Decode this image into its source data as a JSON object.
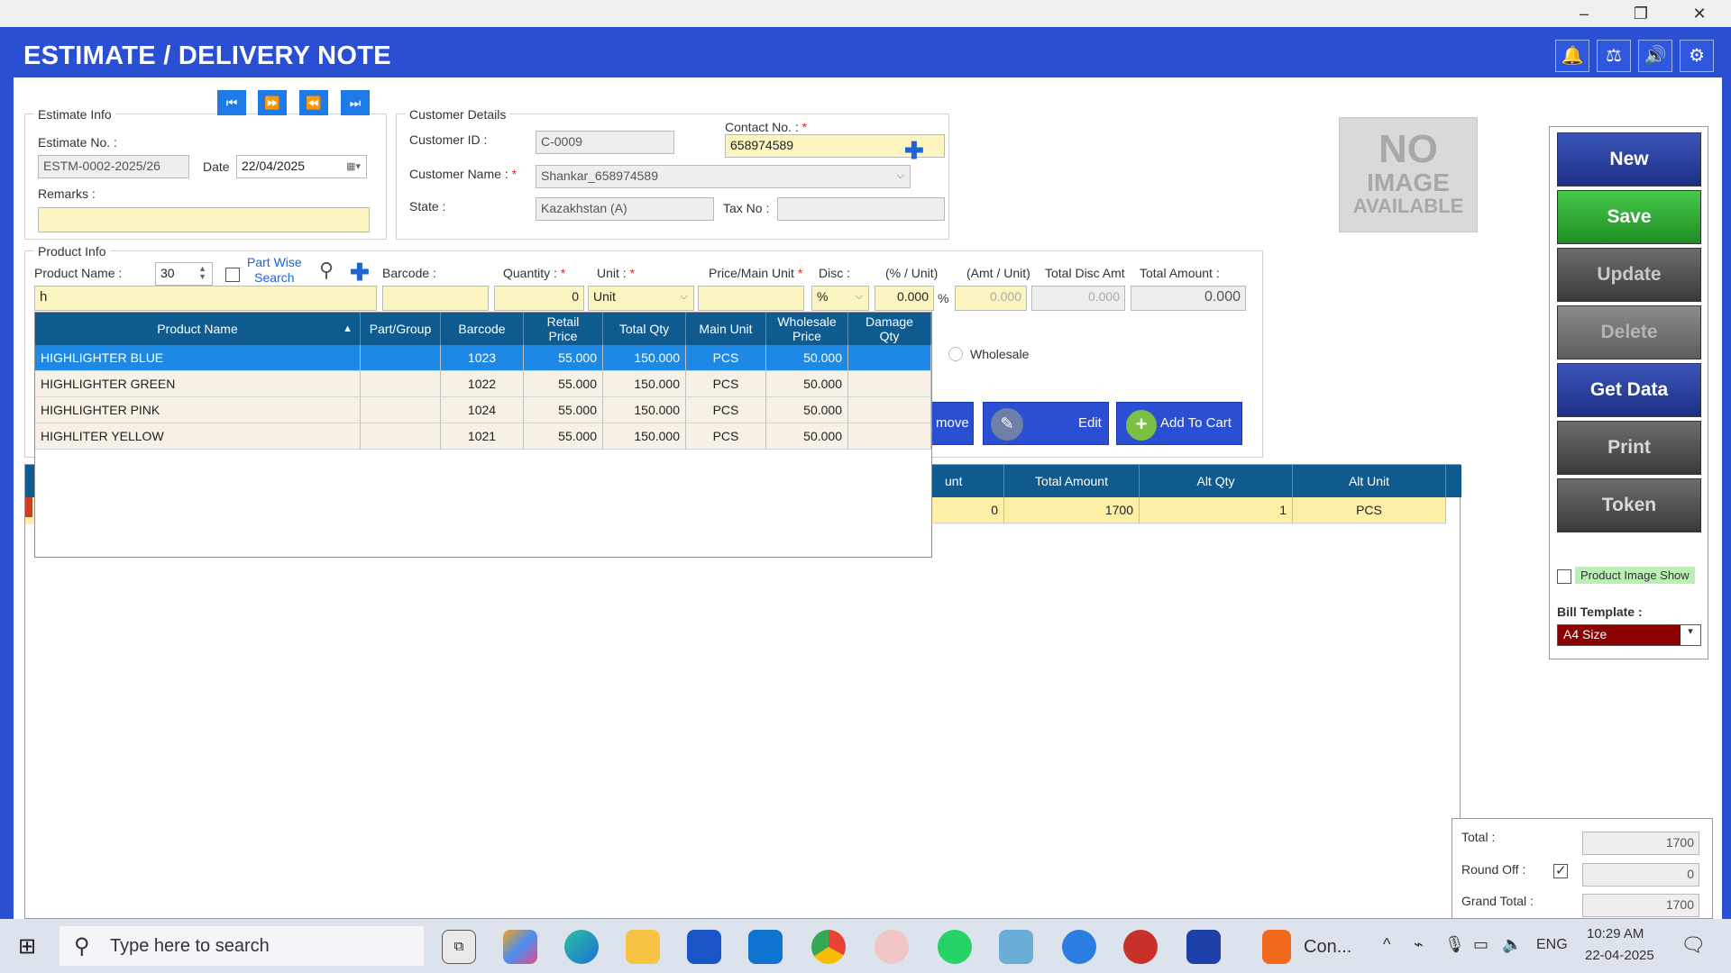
{
  "window": {
    "minimize": "–",
    "restore": "❐",
    "close": "✕"
  },
  "header": {
    "title": "ESTIMATE  /  DELIVERY NOTE",
    "icons": [
      "bell-icon",
      "scale-icon",
      "speaker-icon",
      "gear-icon"
    ]
  },
  "estimate_info": {
    "group_title": "Estimate Info",
    "estimate_no_label": "Estimate No. :",
    "estimate_no": "ESTM-0002-2025/26",
    "date_label": "Date",
    "date": "22/04/2025",
    "remarks_label": "Remarks :",
    "remarks": ""
  },
  "customer": {
    "group_title": "Customer Details",
    "customer_id_label": "Customer ID :",
    "customer_id": "C-0009",
    "contact_label": "Contact No. :",
    "contact": "658974589",
    "name_label": "Customer Name :",
    "name": "Shankar_658974589",
    "state_label": "State :",
    "state": "Kazakhstan (A)",
    "tax_label": "Tax No :",
    "tax": ""
  },
  "no_image": {
    "line1": "NO",
    "line2": "IMAGE",
    "line3": "AVAILABLE"
  },
  "product_info": {
    "group_title": "Product Info",
    "product_name_label": "Product Name :",
    "count": "30",
    "part_wise_line1": "Part Wise",
    "part_wise_line2": "Search",
    "barcode_label": "Barcode :",
    "quantity_label": "Quantity :",
    "unit_label": "Unit :",
    "price_label": "Price/Main Unit",
    "disc_label": "Disc :",
    "pct_unit_label": "(% / Unit)",
    "amt_unit_label": "(Amt / Unit)",
    "total_disc_label": "Total Disc Amt",
    "total_amount_label": "Total Amount :",
    "product_name_value": "h",
    "barcode_value": "",
    "quantity_value": "0",
    "unit_value": "Unit",
    "price_value": "",
    "disc_type": "%",
    "disc_pct": "0.000",
    "pct_symbol": "%",
    "amt_unit": "0.000",
    "total_disc": "0.000",
    "total_amount": "0.000",
    "wholesale_label": "Wholesale",
    "remove_label": "move",
    "edit_label": "Edit",
    "add_to_cart_label": "Add To Cart"
  },
  "suggestions": {
    "columns": [
      "Product Name",
      "Part/Group",
      "Barcode",
      "Retail Price",
      "Total Qty",
      "Main Unit",
      "Wholesale Price",
      "Damage Qty"
    ],
    "sort_indicator": "▲",
    "rows": [
      {
        "name": "HIGHLIGHTER BLUE",
        "group": "",
        "barcode": "1023",
        "retail": "55.000",
        "qty": "150.000",
        "unit": "PCS",
        "wholesale": "50.000",
        "damage": ""
      },
      {
        "name": "HIGHLIGHTER GREEN",
        "group": "",
        "barcode": "1022",
        "retail": "55.000",
        "qty": "150.000",
        "unit": "PCS",
        "wholesale": "50.000",
        "damage": ""
      },
      {
        "name": "HIGHLIGHTER PINK",
        "group": "",
        "barcode": "1024",
        "retail": "55.000",
        "qty": "150.000",
        "unit": "PCS",
        "wholesale": "50.000",
        "damage": ""
      },
      {
        "name": "HIGHLITER YELLOW",
        "group": "",
        "barcode": "1021",
        "retail": "55.000",
        "qty": "150.000",
        "unit": "PCS",
        "wholesale": "50.000",
        "damage": ""
      }
    ]
  },
  "cart": {
    "columns": [
      "unt",
      "Total Amount",
      "Alt Qty",
      "Alt Unit"
    ],
    "row": {
      "disc": "0",
      "total": "1700",
      "alt_qty": "1",
      "alt_unit": "PCS"
    }
  },
  "side_buttons": {
    "new": "New",
    "save": "Save",
    "update": "Update",
    "delete": "Delete",
    "get_data": "Get Data",
    "print": "Print",
    "token": "Token",
    "product_image_show": "Product Image Show",
    "bill_template_label": "Bill Template :",
    "bill_template": "A4 Size"
  },
  "totals": {
    "total_label": "Total :",
    "total": "1700",
    "round_off_label": "Round Off :",
    "round_off": "0",
    "grand_total_label": "Grand Total :",
    "grand_total": "1700"
  },
  "taskbar": {
    "search_placeholder": "Type here to search",
    "app_label": "Con...",
    "lang": "ENG",
    "time": "10:29 AM",
    "date": "22-04-2025"
  },
  "colors": {
    "accent": "#2a4fd3",
    "grid_header": "#0f5b90",
    "selected_row": "#1e88e5",
    "highlight_yellow": "#fcf5c2"
  }
}
